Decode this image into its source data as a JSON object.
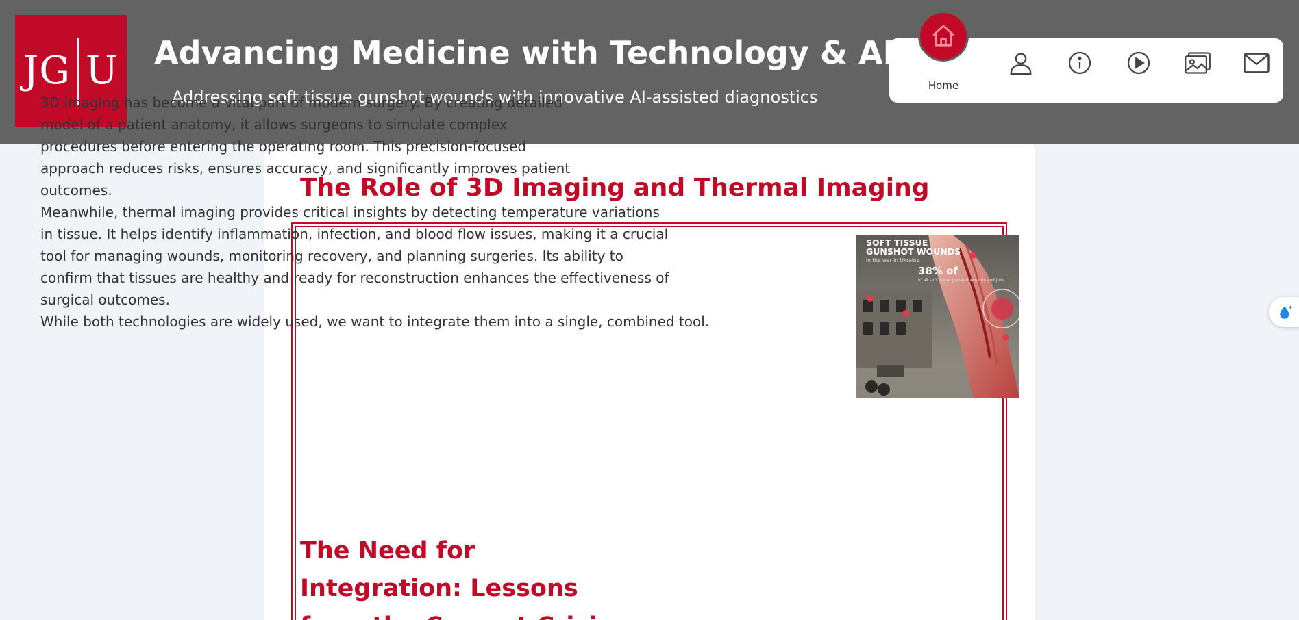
{
  "header": {
    "logo_text": "JG|U",
    "title": "Advancing Medicine with Technology & AI",
    "subtitle": "Addressing soft tissue gunshot wounds with innovative AI-assisted diagnostics"
  },
  "nav": {
    "home_label": "Home",
    "icons": [
      "home-icon",
      "user-icon",
      "info-icon",
      "play-icon",
      "gallery-icon",
      "mail-icon"
    ],
    "accent_color": "#c10a27"
  },
  "main": {
    "section_title": "The Role of 3D Imaging and Thermal Imaging",
    "paragraphs": [
      "3D imaging has become a vital part of modern surgery. By creating detailed model of a patient anatomy, it allows surgeons to simulate complex procedures before entering the operating room. This precision-focused approach reduces risks, ensures accuracy, and significantly improves patient outcomes.",
      "Meanwhile, thermal imaging provides critical insights by detecting temperature variations in tissue. It helps identify inflammation, infection, and blood flow issues, making it a crucial tool for managing wounds, monitoring recovery, and planning surgeries. Its ability to confirm that tissues are healthy and ready for reconstruction enhances the effectiveness of surgical outcomes.",
      "While both technologies are widely used, we want to integrate them into a single, combined tool."
    ],
    "image": {
      "title_line1": "SOFT TISSUE",
      "title_line2": "GUNSHOT WOUNDS",
      "caption": "in the war in Ukraine",
      "stat": "38% of",
      "stat_sub": "of all soft tissue gunshot wounds and joint"
    },
    "second_title": "The Need for Integration: Lessons from the Current Crisis"
  },
  "colors": {
    "header_bg": "#636363",
    "brand_red": "#c10a27",
    "page_bg": "#f0f3f7"
  }
}
